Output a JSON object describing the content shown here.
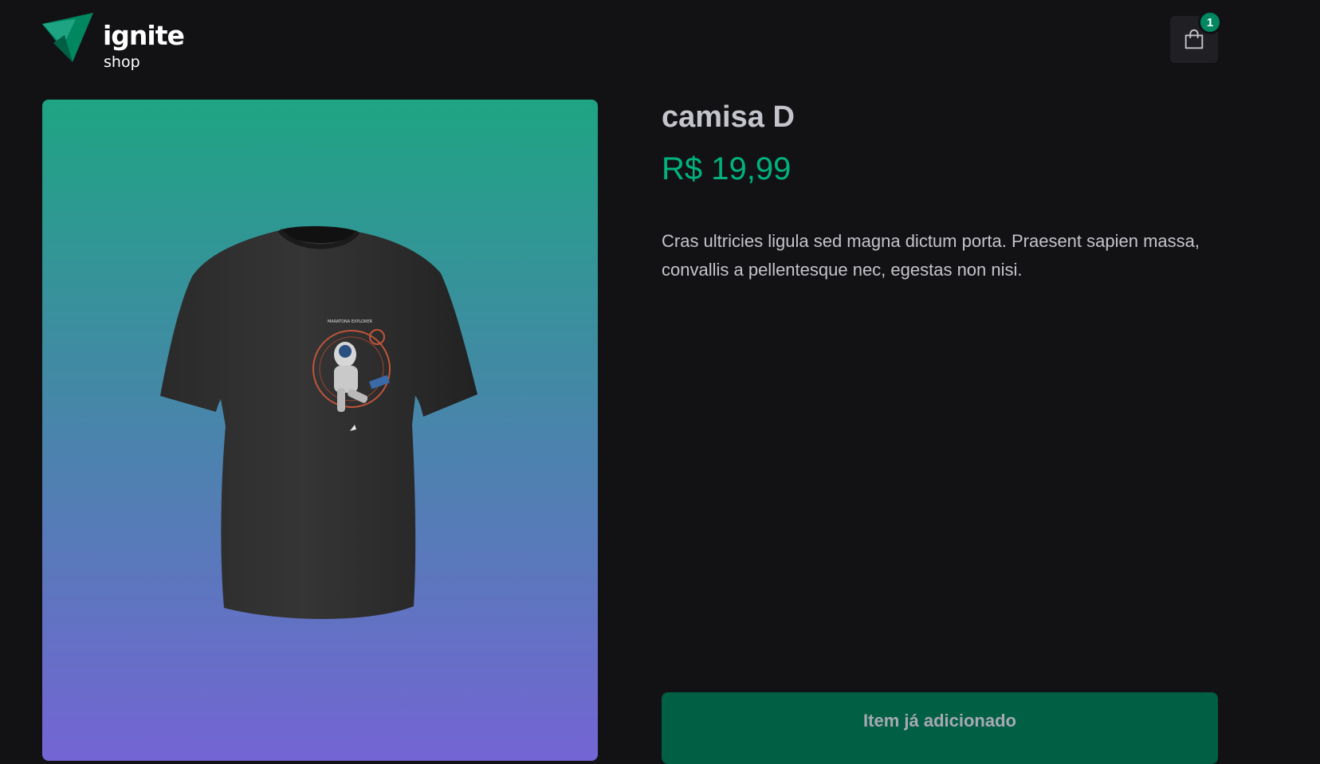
{
  "header": {
    "logo": {
      "title": "ignite",
      "subtitle": "shop"
    },
    "cart": {
      "icon": "handbag-icon",
      "badge_count": "1"
    }
  },
  "product": {
    "image_alt": "camisa D",
    "print_text": "MARATONA EXPLORER",
    "title": "camisa D",
    "price": "R$ 19,99",
    "description": "Cras ultricies ligula sed magna dictum porta. Praesent sapien massa, convallis a pellentesque nec, egestas non nisi.",
    "button_label": "Item já adicionado"
  },
  "colors": {
    "background": "#121214",
    "accent": "#00875f",
    "price": "#00b37e",
    "button": "#015f43",
    "gradient_top": "#1ea483",
    "gradient_bottom": "#7465d4"
  }
}
